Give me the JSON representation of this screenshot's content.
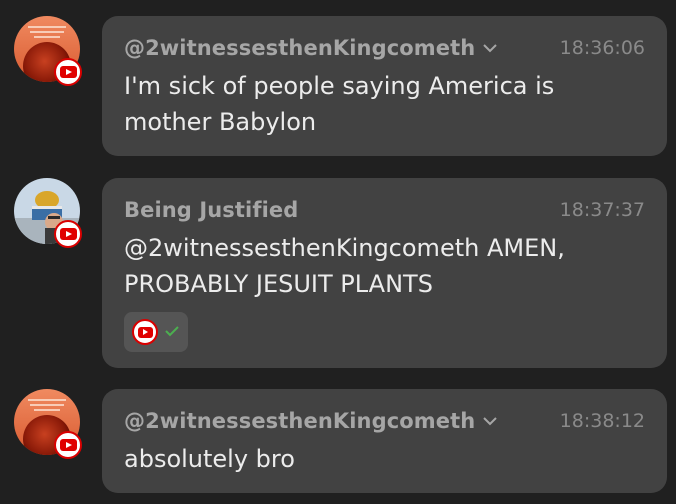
{
  "messages": [
    {
      "author": "@2witnessesthenKingcometh",
      "time": "18:36:06",
      "text": "I'm sick of people saying America is mother Babylon",
      "has_menu": true,
      "avatar_icon": "blood-moon-avatar",
      "badge_icon": "youtube-icon"
    },
    {
      "author": "Being Justified",
      "time": "18:37:37",
      "text": "@2witnessesthenKingcometh AMEN, PROBABLY JESUIT PLANTS",
      "has_menu": false,
      "avatar_icon": "dome-of-the-rock-avatar",
      "badge_icon": "youtube-icon",
      "reaction_icons": [
        "youtube-icon",
        "check-icon"
      ]
    },
    {
      "author": "@2witnessesthenKingcometh",
      "time": "18:38:12",
      "text": "absolutely bro",
      "has_menu": true,
      "avatar_icon": "blood-moon-avatar",
      "badge_icon": "youtube-icon"
    }
  ],
  "colors": {
    "background": "#202020",
    "bubble": "#424242",
    "author": "#a6a6a6",
    "timestamp": "#8a8a8a",
    "message_text": "#ececec",
    "youtube_red": "#e00000",
    "check_green": "#4caf50"
  }
}
